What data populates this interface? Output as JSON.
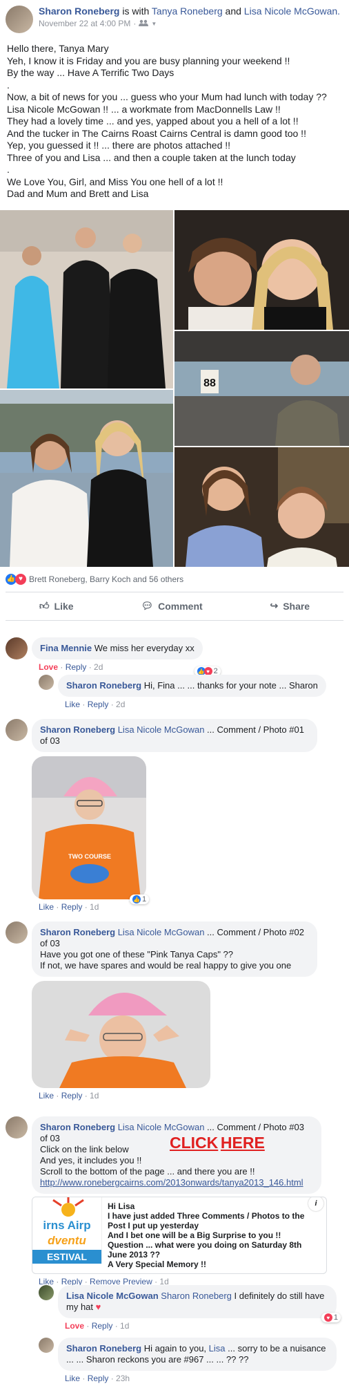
{
  "post": {
    "author": "Sharon Roneberg",
    "with_text": "is with",
    "tag1": "Tanya Roneberg",
    "and_text": "and",
    "tag2": "Lisa Nicole McGowan.",
    "timestamp": "November 22 at 4:00 PM",
    "audience_icon": "friends-icon",
    "body": "Hello there, Tanya Mary\nYeh, I know it is Friday and you are busy planning your weekend !!\nBy the way ... Have A Terrific Two Days\n.\nNow, a bit of news for you ... guess who your Mum had lunch with today ??\nLisa Nicole McGowan !! ... a workmate from MacDonnells Law !!\nThey had a lovely time ... and yes, yapped about you a hell of a lot !!\nAnd the tucker in The Cairns Roast Cairns Central is damn good too !!\nYep, you guessed it !! ... there are photos attached !!\nThree of you and Lisa ... and then a couple taken at the lunch today\n.\nWe Love You, Girl, and Miss You one hell of a lot !!\nDad and Mum and Brett and Lisa",
    "photo_sign": "88",
    "reactions_text": "Brett Roneberg, Barry Koch and 56 others",
    "actions": {
      "like": "Like",
      "comment": "Comment",
      "share": "Share"
    }
  },
  "comments": [
    {
      "name": "Fina Mennie",
      "text": "We miss her everyday xx",
      "love": "Love",
      "reply": "Reply",
      "time": "2d",
      "reaction_count": "2"
    },
    {
      "name": "Sharon Roneberg",
      "text": "Hi, Fina ... ... thanks for your note ... Sharon",
      "like": "Like",
      "reply": "Reply",
      "time": "2d"
    },
    {
      "name": "Sharon Roneberg",
      "tag": "Lisa Nicole McGowan",
      "text": "... Comment / Photo #01 of 03",
      "like": "Like",
      "reply": "Reply",
      "time": "1d",
      "reaction_count": "1",
      "shirt_text": "TWO COURSE"
    },
    {
      "name": "Sharon Roneberg",
      "tag": "Lisa Nicole McGowan",
      "text": "... Comment / Photo #02 of 03",
      "text2": "Have you got one of these \"Pink Tanya Caps\" ??",
      "text3": "If not, we have spares and would be real happy to give you one",
      "like": "Like",
      "reply": "Reply",
      "time": "1d"
    },
    {
      "name": "Sharon Roneberg",
      "tag": "Lisa Nicole McGowan",
      "text": "... Comment / Photo #03 of 03",
      "line1": "Click on the link below",
      "line2": "And yes, it includes you !!",
      "line3": "Scroll to the bottom of the page ... and there you are !!",
      "url": "http://www.ronebergcairns.com/2013onwards/tanya2013_146.html",
      "click": "CLICK",
      "here": "HERE",
      "preview_logo_1": "irns Airp",
      "preview_logo_2": "dventu",
      "preview_logo_3": "ESTIVAL",
      "preview_text": "Hi Lisa\nI have just added Three Comments / Photos to the Post I put up yesterday\nAnd I bet one will be a Big Surprise to you !!\nQuestion ... what were you doing on Saturday 8th June 2013 ??\nA Very Special Memory !!",
      "info": "i",
      "like": "Like",
      "reply": "Reply",
      "remove": "Remove Preview",
      "time": "1d"
    },
    {
      "name": "Lisa Nicole McGowan",
      "tag": "Sharon Roneberg",
      "text": "I definitely do still have my hat",
      "love": "Love",
      "reply": "Reply",
      "time": "1d",
      "reaction_count": "1"
    },
    {
      "name": "Sharon Roneberg",
      "text_a": "Hi again to you,",
      "tag": "Lisa",
      "text_b": "... sorry to be a nuisance ... ... Sharon reckons you are #967 ... ... ?? ??",
      "like": "Like",
      "reply": "Reply",
      "time": "23h"
    }
  ]
}
